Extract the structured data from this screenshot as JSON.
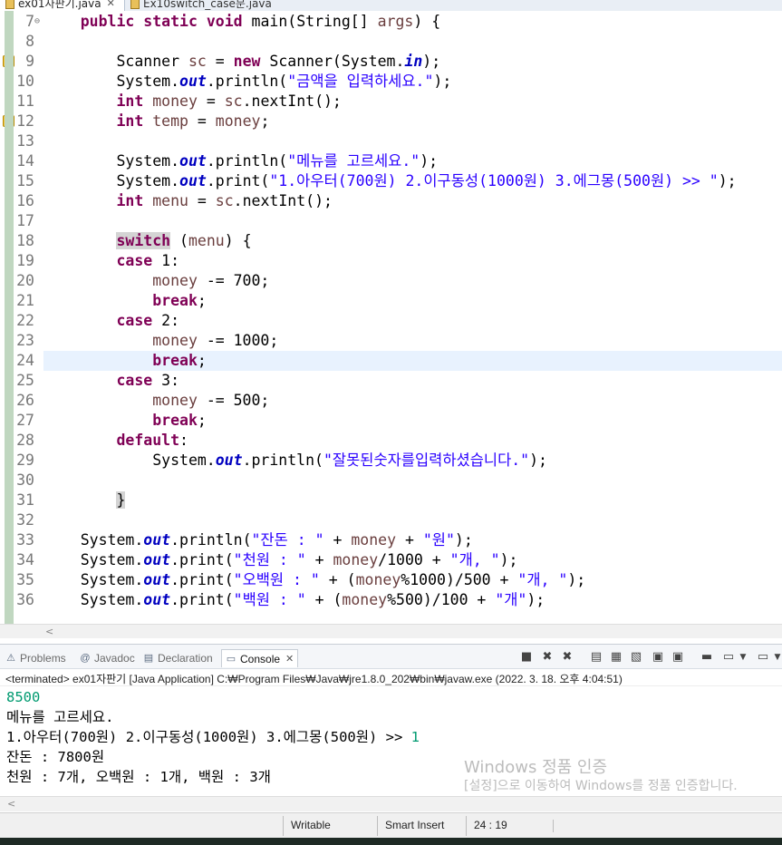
{
  "editor_tabs": [
    {
      "label": "ex01자판기.java"
    },
    {
      "label": "Ex10switch_case문.java"
    }
  ],
  "editor": {
    "current_line": 24,
    "lines": [
      {
        "n": "7",
        "fold": "⊖",
        "segs": [
          [
            "",
            "    "
          ],
          [
            "kw",
            "public"
          ],
          [
            "",
            " "
          ],
          [
            "kw",
            "static"
          ],
          [
            "",
            " "
          ],
          [
            "kw",
            "void"
          ],
          [
            "",
            " main(String[] "
          ],
          [
            "var",
            "args"
          ],
          [
            "",
            ") {"
          ]
        ]
      },
      {
        "n": "8",
        "segs": []
      },
      {
        "n": "9",
        "marker": true,
        "segs": [
          [
            "",
            "        Scanner "
          ],
          [
            "var",
            "sc"
          ],
          [
            "",
            " = "
          ],
          [
            "kw",
            "new"
          ],
          [
            "",
            " Scanner(System."
          ],
          [
            "fld",
            "in"
          ],
          [
            "",
            ");"
          ]
        ]
      },
      {
        "n": "10",
        "segs": [
          [
            "",
            "        System."
          ],
          [
            "fld",
            "out"
          ],
          [
            "",
            ".println("
          ],
          [
            "str",
            "\"금액을 입력하세요.\""
          ],
          [
            "",
            ");"
          ]
        ]
      },
      {
        "n": "11",
        "segs": [
          [
            "",
            "        "
          ],
          [
            "kw",
            "int"
          ],
          [
            "",
            " "
          ],
          [
            "var",
            "money"
          ],
          [
            "",
            " = "
          ],
          [
            "var",
            "sc"
          ],
          [
            "",
            ".nextInt();"
          ]
        ]
      },
      {
        "n": "12",
        "marker": true,
        "segs": [
          [
            "",
            "        "
          ],
          [
            "kw",
            "int"
          ],
          [
            "",
            " "
          ],
          [
            "var",
            "temp"
          ],
          [
            "",
            " = "
          ],
          [
            "var",
            "money"
          ],
          [
            "",
            ";"
          ]
        ]
      },
      {
        "n": "13",
        "segs": []
      },
      {
        "n": "14",
        "segs": [
          [
            "",
            "        System."
          ],
          [
            "fld",
            "out"
          ],
          [
            "",
            ".println("
          ],
          [
            "str",
            "\"메뉴를 고르세요.\""
          ],
          [
            "",
            ");"
          ]
        ]
      },
      {
        "n": "15",
        "segs": [
          [
            "",
            "        System."
          ],
          [
            "fld",
            "out"
          ],
          [
            "",
            ".print("
          ],
          [
            "str",
            "\"1.아우터(700원) 2.이구동성(1000원) 3.에그몽(500원) >> \""
          ],
          [
            "",
            ");"
          ]
        ]
      },
      {
        "n": "16",
        "segs": [
          [
            "",
            "        "
          ],
          [
            "kw",
            "int"
          ],
          [
            "",
            " "
          ],
          [
            "var",
            "menu"
          ],
          [
            "",
            " = "
          ],
          [
            "var",
            "sc"
          ],
          [
            "",
            ".nextInt();"
          ]
        ]
      },
      {
        "n": "17",
        "segs": []
      },
      {
        "n": "18",
        "segs": [
          [
            "",
            "        "
          ],
          [
            "kw hl",
            "switch"
          ],
          [
            "",
            " ("
          ],
          [
            "var",
            "menu"
          ],
          [
            "",
            ") {"
          ]
        ]
      },
      {
        "n": "19",
        "segs": [
          [
            "",
            "        "
          ],
          [
            "kw",
            "case"
          ],
          [
            "",
            " 1:"
          ]
        ]
      },
      {
        "n": "20",
        "segs": [
          [
            "",
            "            "
          ],
          [
            "var",
            "money"
          ],
          [
            "",
            " -= 700;"
          ]
        ]
      },
      {
        "n": "21",
        "segs": [
          [
            "",
            "            "
          ],
          [
            "kw",
            "break"
          ],
          [
            "",
            ";"
          ]
        ]
      },
      {
        "n": "22",
        "segs": [
          [
            "",
            "        "
          ],
          [
            "kw",
            "case"
          ],
          [
            "",
            " 2:"
          ]
        ]
      },
      {
        "n": "23",
        "segs": [
          [
            "",
            "            "
          ],
          [
            "var",
            "money"
          ],
          [
            "",
            " -= 1000;"
          ]
        ]
      },
      {
        "n": "24",
        "segs": [
          [
            "",
            "            "
          ],
          [
            "kw",
            "break"
          ],
          [
            "",
            ";"
          ]
        ]
      },
      {
        "n": "25",
        "segs": [
          [
            "",
            "        "
          ],
          [
            "kw",
            "case"
          ],
          [
            "",
            " 3:"
          ]
        ]
      },
      {
        "n": "26",
        "segs": [
          [
            "",
            "            "
          ],
          [
            "var",
            "money"
          ],
          [
            "",
            " -= 500;"
          ]
        ]
      },
      {
        "n": "27",
        "segs": [
          [
            "",
            "            "
          ],
          [
            "kw",
            "break"
          ],
          [
            "",
            ";"
          ]
        ]
      },
      {
        "n": "28",
        "segs": [
          [
            "",
            "        "
          ],
          [
            "kw",
            "default"
          ],
          [
            "",
            ":"
          ]
        ]
      },
      {
        "n": "29",
        "segs": [
          [
            "",
            "            System."
          ],
          [
            "fld",
            "out"
          ],
          [
            "",
            ".println("
          ],
          [
            "str",
            "\"잘못된숫자를입력하셨습니다.\""
          ],
          [
            "",
            ");"
          ]
        ]
      },
      {
        "n": "30",
        "segs": []
      },
      {
        "n": "31",
        "segs": [
          [
            "",
            "        "
          ],
          [
            "hl",
            "}"
          ]
        ]
      },
      {
        "n": "32",
        "segs": []
      },
      {
        "n": "33",
        "segs": [
          [
            "",
            "    System."
          ],
          [
            "fld",
            "out"
          ],
          [
            "",
            ".println("
          ],
          [
            "str",
            "\"잔돈 : \""
          ],
          [
            "",
            " + "
          ],
          [
            "var",
            "money"
          ],
          [
            "",
            " + "
          ],
          [
            "str",
            "\"원\""
          ],
          [
            "",
            ");"
          ]
        ]
      },
      {
        "n": "34",
        "segs": [
          [
            "",
            "    System."
          ],
          [
            "fld",
            "out"
          ],
          [
            "",
            ".print("
          ],
          [
            "str",
            "\"천원 : \""
          ],
          [
            "",
            " + "
          ],
          [
            "var",
            "money"
          ],
          [
            "",
            "/1000 + "
          ],
          [
            "str",
            "\"개, \""
          ],
          [
            "",
            ");"
          ]
        ]
      },
      {
        "n": "35",
        "segs": [
          [
            "",
            "    System."
          ],
          [
            "fld",
            "out"
          ],
          [
            "",
            ".print("
          ],
          [
            "str",
            "\"오백원 : \""
          ],
          [
            "",
            " + ("
          ],
          [
            "var",
            "money"
          ],
          [
            "",
            "%1000)/500 + "
          ],
          [
            "str",
            "\"개, \""
          ],
          [
            "",
            ");"
          ]
        ]
      },
      {
        "n": "36",
        "segs": [
          [
            "",
            "    System."
          ],
          [
            "fld",
            "out"
          ],
          [
            "",
            ".print("
          ],
          [
            "str",
            "\"백원 : \""
          ],
          [
            "",
            " + ("
          ],
          [
            "var",
            "money"
          ],
          [
            "",
            "%500)/100 + "
          ],
          [
            "str",
            "\"개\""
          ],
          [
            "",
            ");"
          ]
        ]
      }
    ]
  },
  "views": {
    "tabs": [
      {
        "label": "Problems",
        "icon": "problems-icon"
      },
      {
        "label": "Javadoc",
        "icon": "javadoc-icon"
      },
      {
        "label": "Declaration",
        "icon": "declaration-icon"
      },
      {
        "label": "Console",
        "icon": "console-icon",
        "close": "✕"
      }
    ]
  },
  "console": {
    "info": "<terminated> ex01자판기 [Java Application] C:₩Program Files₩Java₩jre1.8.0_202₩bin₩javaw.exe (2022. 3. 18. 오후 4:04:51)",
    "input_amount": "8500",
    "prompt_menu": "메뉴를 고르세요.",
    "menu_options": "1.아우터(700원) 2.이구동성(1000원) 3.에그몽(500원) >> ",
    "input_menu": "1",
    "change": "잔돈 : 7800원",
    "breakdown": "천원 : 7개, 오백원 : 1개, 백원 : 3개"
  },
  "watermark": {
    "line1": "Windows 정품 인증",
    "line2": "[설정]으로 이동하여 Windows를 정품 인증합니다."
  },
  "status": {
    "mode": "Writable",
    "insert": "Smart Insert",
    "position": "24 : 19"
  },
  "colors": {
    "keyword": "#7f0055",
    "string": "#2a00ff",
    "field": "#0000c0",
    "variable": "#6a3e3e",
    "console_input": "#009a70"
  }
}
